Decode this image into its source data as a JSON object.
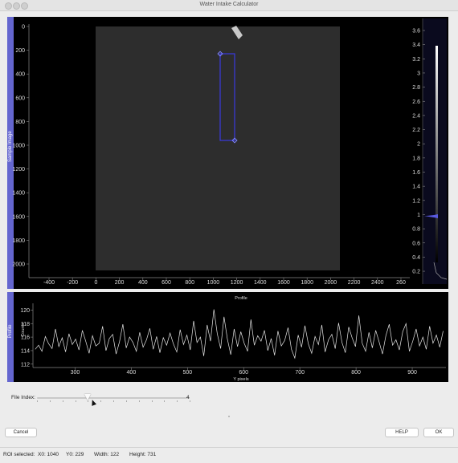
{
  "window": {
    "title": "Water Intake Calculator"
  },
  "image_view": {
    "y_axis_label": "Sample Image",
    "y_ticks": [
      "0",
      "200",
      "400",
      "600",
      "800",
      "1000",
      "1200",
      "1400",
      "1600",
      "1800",
      "2000"
    ],
    "x_ticks": [
      "-400",
      "-200",
      "0",
      "200",
      "400",
      "600",
      "800",
      "1000",
      "1200",
      "1400",
      "1600",
      "1800",
      "2000",
      "2200",
      "2400",
      "260"
    ],
    "colorbar_ticks": [
      "3.6",
      "3.4",
      "3.2",
      "3",
      "2.8",
      "2.6",
      "2.4",
      "2.2",
      "2",
      "1.8",
      "1.6",
      "1.4",
      "1.2",
      "1",
      "0.8",
      "0.6",
      "0.4",
      "0.2"
    ],
    "roi": {
      "x0": 1040,
      "y0": 229,
      "width": 122,
      "height": 731
    }
  },
  "profile": {
    "title": "Profile",
    "side_label": "Profile",
    "y_label": "Counts",
    "x_label": "Y pixels",
    "y_ticks": [
      "120",
      "118",
      "116",
      "114",
      "112"
    ],
    "x_ticks": [
      "300",
      "400",
      "500",
      "600",
      "700",
      "800",
      "900"
    ]
  },
  "chart_data": {
    "type": "line",
    "title": "Profile",
    "xlabel": "Y pixels",
    "ylabel": "Counts",
    "xlim": [
      225,
      960
    ],
    "ylim": [
      111.5,
      121
    ],
    "series": [
      {
        "x": [
          229,
          235,
          241,
          247,
          253,
          259,
          265,
          271,
          277,
          283,
          289,
          295,
          301,
          307,
          313,
          319,
          325,
          331,
          337,
          343,
          349,
          355,
          361,
          367,
          373,
          379,
          385,
          391,
          397,
          403,
          409,
          415,
          421,
          427,
          433,
          439,
          445,
          451,
          457,
          463,
          469,
          475,
          481,
          487,
          493,
          499,
          505,
          511,
          517,
          523,
          529,
          535,
          541,
          547,
          553,
          559,
          565,
          571,
          577,
          583,
          589,
          595,
          601,
          607,
          613,
          619,
          625,
          631,
          637,
          643,
          649,
          655,
          661,
          667,
          673,
          679,
          685,
          691,
          697,
          703,
          709,
          715,
          721,
          727,
          733,
          739,
          745,
          751,
          757,
          763,
          769,
          775,
          781,
          787,
          793,
          799,
          805,
          811,
          817,
          823,
          829,
          835,
          841,
          847,
          853,
          859,
          865,
          871,
          877,
          883,
          889,
          895,
          901,
          907,
          913,
          919,
          925,
          931,
          937,
          943,
          949,
          955
        ],
        "values": [
          114.2,
          114.8,
          113.9,
          116.1,
          115.0,
          114.3,
          117.2,
          114.6,
          115.9,
          113.8,
          116.5,
          114.9,
          115.7,
          114.1,
          117.0,
          115.4,
          113.6,
          116.2,
          114.7,
          115.1,
          117.6,
          114.0,
          115.8,
          116.4,
          113.5,
          115.3,
          117.9,
          114.4,
          116.0,
          115.2,
          113.9,
          116.7,
          114.5,
          115.6,
          117.3,
          114.2,
          116.1,
          113.7,
          115.9,
          114.8,
          116.6,
          115.0,
          113.8,
          117.1,
          114.9,
          116.3,
          114.1,
          118.4,
          115.2,
          116.0,
          113.2,
          117.8,
          115.4,
          120.1,
          116.5,
          114.3,
          119.0,
          115.7,
          113.4,
          117.2,
          114.6,
          116.8,
          115.1,
          113.9,
          118.6,
          114.8,
          116.2,
          115.4,
          117.0,
          114.0,
          115.8,
          113.3,
          116.9,
          114.7,
          115.5,
          117.4,
          114.2,
          112.9,
          116.3,
          114.5,
          117.7,
          115.0,
          113.6,
          116.1,
          114.9,
          117.8,
          113.8,
          115.6,
          116.4,
          114.3,
          118.1,
          115.2,
          113.7,
          117.5,
          115.9,
          114.6,
          119.2,
          115.1,
          113.9,
          116.7,
          114.4,
          117.0,
          115.3,
          113.5,
          116.2,
          117.9,
          114.8,
          115.6,
          114.1,
          116.8,
          118.0,
          113.9,
          115.4,
          117.2,
          114.7,
          116.0,
          114.2,
          117.6,
          115.1,
          116.3,
          114.5,
          116.9
        ]
      }
    ]
  },
  "file_index": {
    "label": "File Index:",
    "value": "4",
    "position": 0.33
  },
  "buttons": {
    "cancel": "Cancel",
    "help": "HELP",
    "ok": "OK"
  },
  "status": {
    "roi_label": "ROI selected:",
    "x0": "X0:  1040",
    "y0": "Y0:  229",
    "width": "Width:  122",
    "height": "Height:  731"
  },
  "colors": {
    "accent": "#6466cf",
    "roi": "#3a3adf",
    "colorbar_fill": "#5a5ae0"
  }
}
